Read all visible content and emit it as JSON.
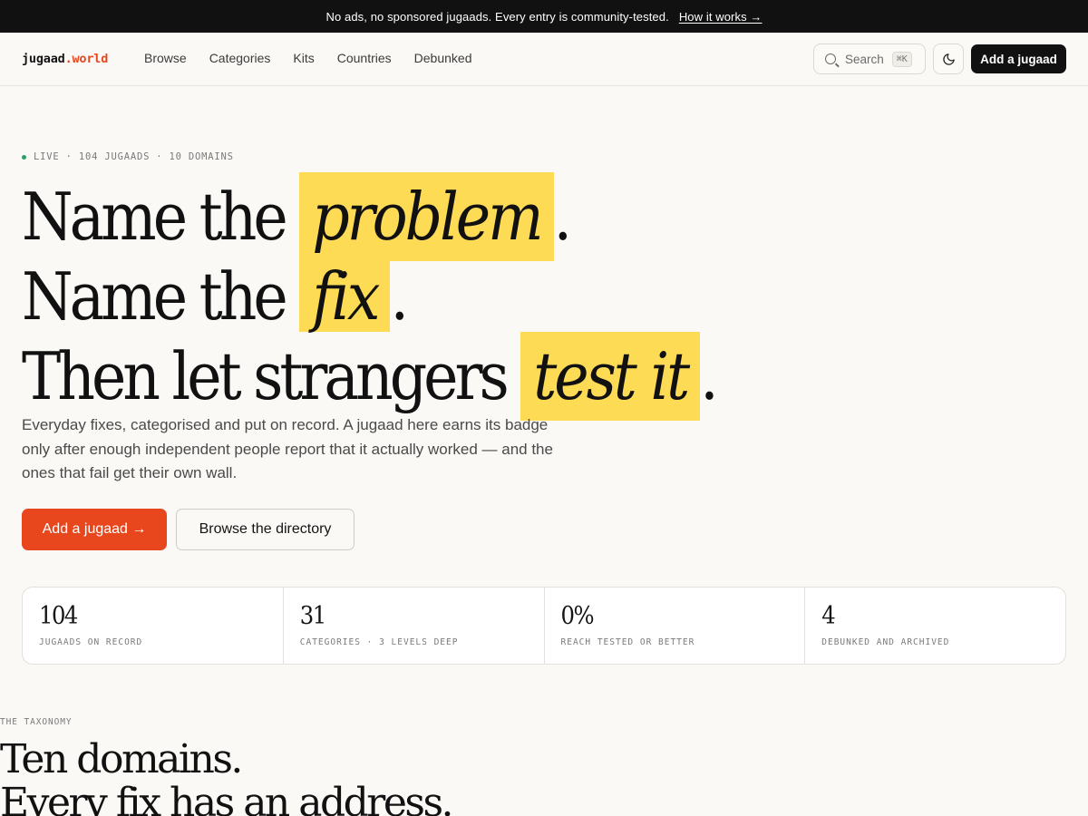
{
  "announcement": {
    "text": "No ads, no sponsored jugaads. Every entry is community-tested.",
    "link": "How it works →"
  },
  "header": {
    "logo_main": "jugaad",
    "logo_accent": ".world",
    "nav": [
      "Browse",
      "Categories",
      "Kits",
      "Countries",
      "Debunked"
    ],
    "search_label": "Search",
    "search_shortcut": "⌘K",
    "add_button": "Add a jugaad"
  },
  "hero": {
    "eyebrow": "LIVE · 104 JUGAADS · 10 DOMAINS",
    "line1_prefix": "Name the ",
    "line1_highlight": "problem",
    "line1_suffix": ".",
    "line2_prefix": "Name the ",
    "line2_highlight": "fix",
    "line2_suffix": ".",
    "line3_prefix": "Then let strangers ",
    "line3_highlight": "test it",
    "line3_suffix": ".",
    "subtitle": "Everyday fixes, categorised and put on record. A jugaad here earns its badge only after enough independent people report that it actually worked — and the ones that fail get their own wall.",
    "primary_button": "Add a jugaad →",
    "secondary_button": "Browse the directory"
  },
  "stats": [
    {
      "value": "104",
      "label": "JUGAADS ON RECORD"
    },
    {
      "value": "31",
      "label": "CATEGORIES · 3 LEVELS DEEP"
    },
    {
      "value": "0%",
      "label": "REACH TESTED OR BETTER"
    },
    {
      "value": "4",
      "label": "DEBUNKED AND ARCHIVED"
    }
  ],
  "taxonomy": {
    "eyebrow": "THE TAXONOMY",
    "title_line1": "Ten domains.",
    "title_line2": "Every fix has an address."
  },
  "colors": {
    "accent": "#e8471e",
    "highlight": "#fddb55",
    "live_dot": "#2f9e62",
    "dark": "#111111"
  }
}
